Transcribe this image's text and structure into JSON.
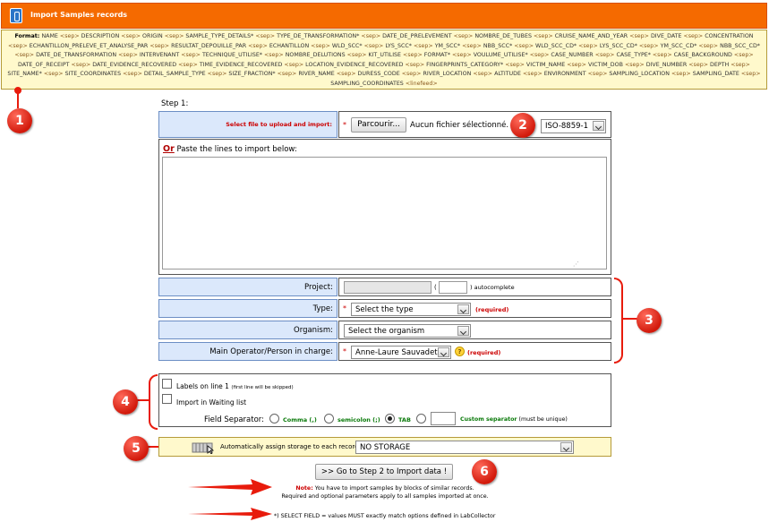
{
  "header": {
    "title": "Import Samples records"
  },
  "format": {
    "label": "Format:",
    "fields": [
      "NAME",
      "DESCRIPTION",
      "ORIGIN",
      "SAMPLE_TYPE_DETAILS*",
      "TYPE_DE_TRANSFORMATION*",
      "DATE_DE_PRELEVEMENT",
      "NOMBRE_DE_TUBES",
      "CRUISE_NAME_AND_YEAR",
      "DIVE_DATE",
      "CONCENTRATION",
      "ECHANTILLON_PRELEVE_ET_ANALYSE_PAR",
      "RESULTAT_DEPOUILLE_PAR",
      "ECHANTILLON",
      "WLD_SCC*",
      "LYS_SCC*",
      "YM_SCC*",
      "NBB_SCC*",
      "WLD_SCC_CD*",
      "LYS_SCC_CD*",
      "YM_SCC_CD*",
      "NBB_SCC_CD*",
      "DATE_DE_TRANSFORMATION",
      "INTERVENANT",
      "TECHNIQUE_UTILISE*",
      "NOMBRE_DELUTIONS",
      "KIT_UTILISE",
      "FORMAT*",
      "VOULUME_UTILISE*",
      "CASE_NUMBER",
      "CASE_TYPE*",
      "CASE_BACKGROUND",
      "DATE_OF_RECEIPT",
      "DATE_EVIDENCE_RECOVERED",
      "TIME_EVIDENCE_RECOVERED",
      "LOCATION_EVIDENCE_RECOVERED",
      "FINGERPRINTS_CATEGORY*",
      "VICTIM_NAME",
      "VICTIM_DOB",
      "DIVE_NUMBER",
      "DEPTH",
      "SITE_NAME*",
      "SITE_COORDINATES",
      "DETAIL_SAMPLE_TYPE",
      "SIZE_FRACTION*",
      "RIVER_NAME",
      "DURESS_CODE",
      "RIVER_LOCATION",
      "ALTITUDE",
      "ENVIRONMENT",
      "SAMPLING_LOCATION",
      "SAMPLING_DATE",
      "SAMPLING_COORDINATES"
    ],
    "sep_token": "<sep>",
    "end_token": "<linefeed>"
  },
  "markers": [
    "1",
    "2",
    "3",
    "4",
    "5",
    "6"
  ],
  "step1": {
    "title": "Step 1:",
    "file_label": "Select file to upload and import:",
    "required_star": "*",
    "browse_button": "Parcourir...",
    "file_status": "Aucun fichier sélectionné.",
    "encoding": "ISO-8859-1",
    "or_text": "Or",
    "paste_label": "Paste the lines to import below:",
    "paste_value": ""
  },
  "fields": {
    "project_label": "Project:",
    "project_paren_open": "(",
    "project_paren_close": ") autocomplete",
    "type_label": "Type:",
    "type_value": "Select the type",
    "type_required": "(required)",
    "organism_label": "Organism:",
    "organism_value": "Select the organism",
    "operator_label": "Main Operator/Person in charge:",
    "operator_value": "Anne-Laure Sauvadet",
    "operator_help": "?",
    "operator_required": "(required)"
  },
  "options": {
    "labels_line1": "Labels on line 1",
    "labels_line1_note": "(first line will be skipped)",
    "waiting_list": "Import in Waiting list",
    "separator_label": "Field Separator:",
    "sep_comma": "Comma (,)",
    "sep_semicolon": "semicolon (;)",
    "sep_tab": "TAB",
    "sep_custom": "Custom separator",
    "sep_custom_note": "(must be unique)",
    "selected_separator": "TAB"
  },
  "storage": {
    "label": "Automatically assign storage to each record:",
    "value": "NO STORAGE"
  },
  "step2_button": ">> Go to Step 2 to Import data !",
  "notes": {
    "note_label": "Note:",
    "note_text": "You have to import samples by blocks of similar records.",
    "note_text2": "Required and optional parameters apply to all samples imported at once.",
    "select_field_note": "*) SELECT FIELD = values MUST exactly match options defined in LabCollector"
  },
  "colors": {
    "header": "#f56a00",
    "format_bg": "#fff9cc",
    "label_bg": "#dbe8fb",
    "marker": "#d21a0c",
    "required": "#cc0000",
    "radio_label": "#0a7a0a"
  }
}
